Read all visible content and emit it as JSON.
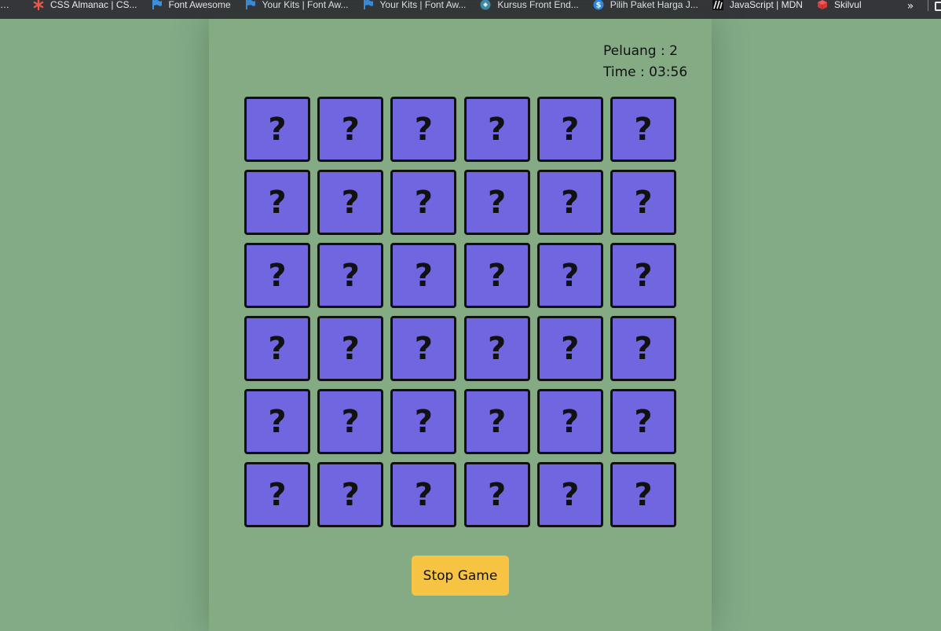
{
  "bookmarks": [
    {
      "label": "…",
      "icon": "bookmark-partial-icon"
    },
    {
      "label": "CSS Almanac | CS...",
      "icon": "asterisk-icon"
    },
    {
      "label": "Font Awesome",
      "icon": "flag-icon"
    },
    {
      "label": "Your Kits | Font Aw...",
      "icon": "flag-icon"
    },
    {
      "label": "Your Kits | Font Aw...",
      "icon": "flag-icon"
    },
    {
      "label": "Kursus Front End...",
      "icon": "circle-logo-icon"
    },
    {
      "label": "Pilih Paket Harga J...",
      "icon": "dollar-circle-icon"
    },
    {
      "label": "JavaScript | MDN",
      "icon": "mdn-icon"
    },
    {
      "label": "Skilvul",
      "icon": "cube-icon"
    }
  ],
  "bookmarks_more": "»",
  "colors": {
    "page_bg": "#83ab86",
    "panel_bg": "#85ab85",
    "card_bg": "#7066e0",
    "card_border": "#111111",
    "button_bg": "#f7c343"
  },
  "game": {
    "chances_label": "Peluang : ",
    "chances_value": "2",
    "time_label": "Time : ",
    "time_value": "03:56",
    "grid_rows": 6,
    "grid_cols": 6,
    "card_symbol": "?",
    "stop_button_label": "Stop Game"
  }
}
